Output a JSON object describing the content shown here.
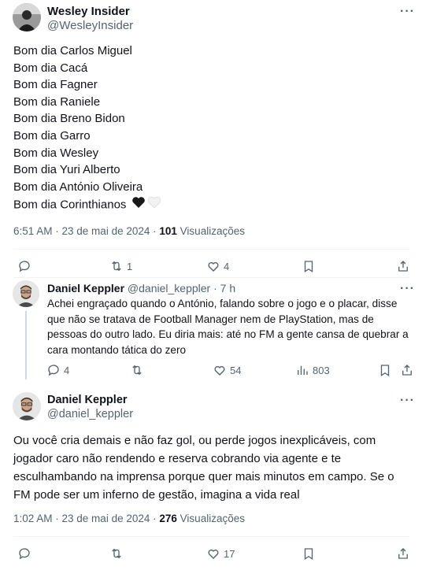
{
  "main_tweet": {
    "author_name": "Wesley Insider",
    "author_handle": "@WesleyInsider",
    "lines": [
      "Bom dia Carlos Miguel",
      "Bom dia Cacá",
      "Bom dia Fagner",
      "Bom dia Raniele",
      "Bom dia Breno Bidon",
      "Bom dia Garro",
      "Bom dia Wesley",
      "Bom dia Yuri Alberto",
      "Bom dia António Oliveira",
      "Bom dia Corinthianos"
    ],
    "emoji": "🖤🤍",
    "timestamp": "6:51 AM · 23 de mai de 2024 · ",
    "views_count": "101",
    "views_label": "Visualizações",
    "retweets": "1",
    "likes": "4"
  },
  "reply": {
    "author_name": "Daniel Keppler",
    "author_handle": "@daniel_keppler",
    "time": "· 7 h",
    "lines": [
      "Achei engraçado quando o António, falando sobre o jogo e o placar, disse",
      "que não se tratava de Football Manager nem de PlayStation, mas de",
      "pessoas do outro lado. Eu diria mais: até no FM a gente cansa de quebrar a",
      "cara montando tática do zero"
    ],
    "replies": "4",
    "likes": "54",
    "views": "803"
  },
  "quote_tweet": {
    "author_name": "Daniel Keppler",
    "author_handle": "@daniel_keppler",
    "lines": [
      "Ou você cria demais e não faz gol, ou perde jogos inexplicáveis, com",
      "jogador caro não rendendo e reserva cobrando via agente e te",
      "esculhambando na imprensa porque quer mais minutos em campo. Se o",
      "FM pode ser um inferno de gestão, imagina a vida real"
    ],
    "timestamp": "1:02 AM · 23 de mai de 2024 · ",
    "views_count": "276",
    "views_label": "Visualizações",
    "likes": "17"
  },
  "colors": {
    "text": "#0f1419",
    "secondary": "#536471",
    "divider": "#eff3f4",
    "thread_line": "#cfd9de"
  },
  "icons": [
    "more-icon",
    "reply-icon",
    "retweet-icon",
    "like-icon",
    "bookmark-icon",
    "share-icon",
    "views-icon"
  ]
}
